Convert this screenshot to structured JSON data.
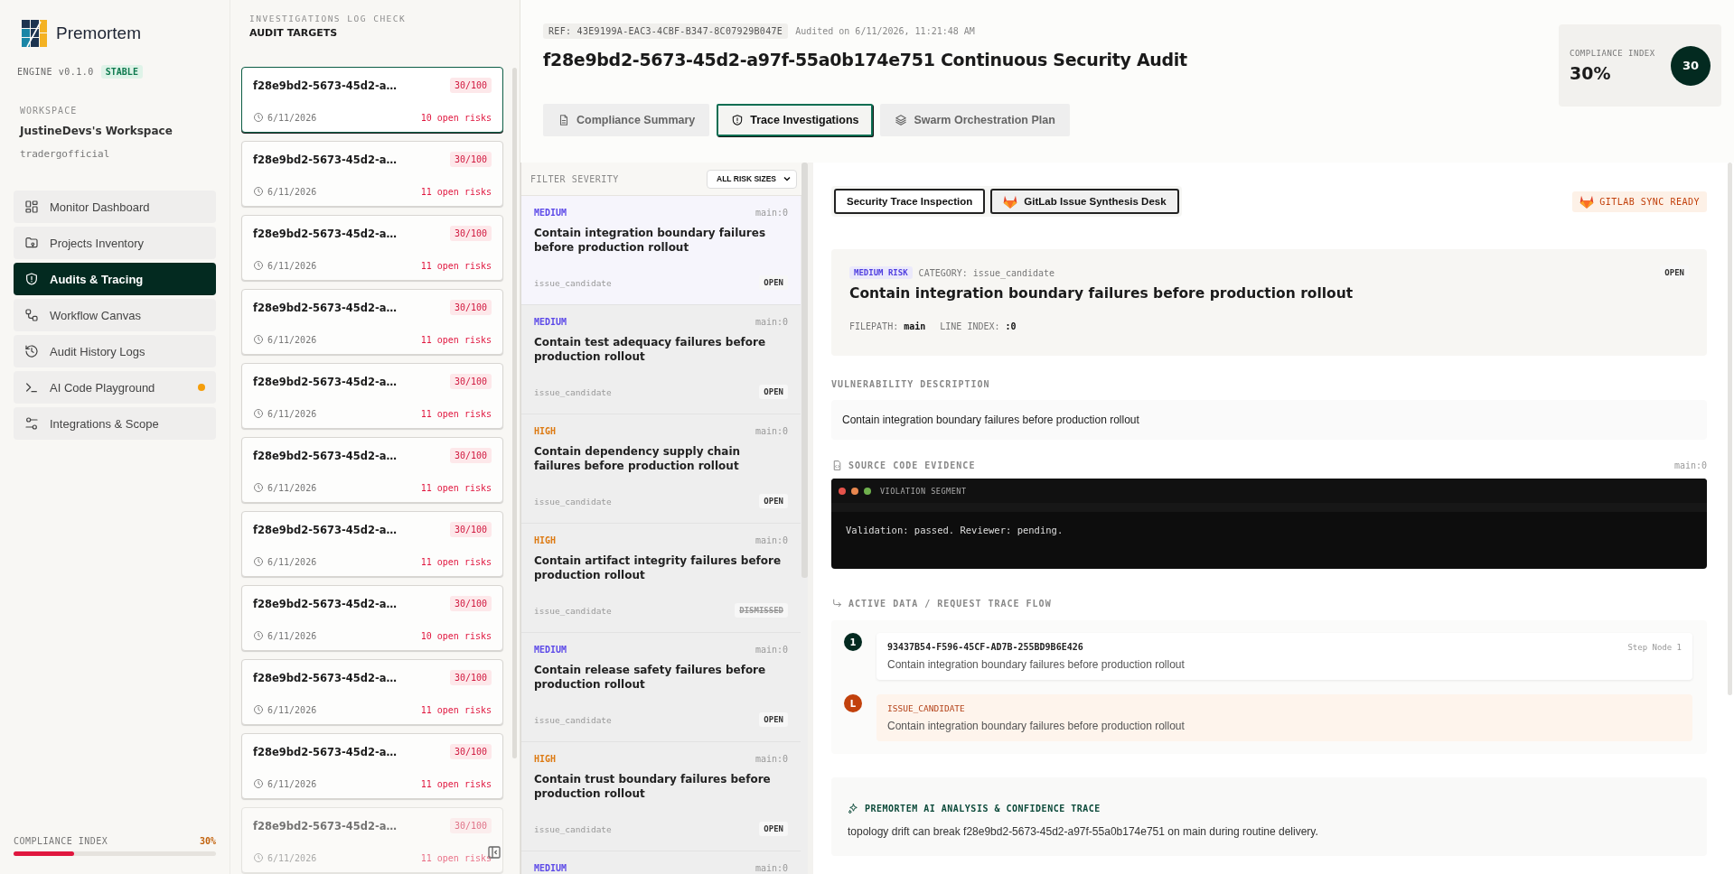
{
  "sidebar": {
    "brand": "Premortem",
    "engine": "ENGINE v0.1.0",
    "engine_badge": "STABLE",
    "workspace_label": "WORKSPACE",
    "workspace_name": "JustineDevs's Workspace",
    "workspace_handle": "tradergofficial",
    "nav": [
      {
        "label": "Monitor Dashboard",
        "selected": false,
        "alert": false
      },
      {
        "label": "Projects Inventory",
        "selected": false,
        "alert": false
      },
      {
        "label": "Audits & Tracing",
        "selected": true,
        "alert": false
      },
      {
        "label": "Workflow Canvas",
        "selected": false,
        "alert": false
      },
      {
        "label": "Audit History Logs",
        "selected": false,
        "alert": false
      },
      {
        "label": "AI Code Playground",
        "selected": false,
        "alert": true
      },
      {
        "label": "Integrations & Scope",
        "selected": false,
        "alert": false
      }
    ],
    "footer": {
      "label": "COMPLIANCE INDEX",
      "value": "30%",
      "level": 0.3
    }
  },
  "audit_list": {
    "eyebrow": "INVESTIGATIONS LOG CHECK",
    "title": "AUDIT TARGETS",
    "items": [
      {
        "name": "f28e9bd2-5673-45d2-a…",
        "score": "30/100",
        "date": "6/11/2026",
        "risks": "10 open risks",
        "selected": true
      },
      {
        "name": "f28e9bd2-5673-45d2-a…",
        "score": "30/100",
        "date": "6/11/2026",
        "risks": "11 open risks",
        "selected": false
      },
      {
        "name": "f28e9bd2-5673-45d2-a…",
        "score": "30/100",
        "date": "6/11/2026",
        "risks": "11 open risks",
        "selected": false
      },
      {
        "name": "f28e9bd2-5673-45d2-a…",
        "score": "30/100",
        "date": "6/11/2026",
        "risks": "11 open risks",
        "selected": false
      },
      {
        "name": "f28e9bd2-5673-45d2-a…",
        "score": "30/100",
        "date": "6/11/2026",
        "risks": "11 open risks",
        "selected": false
      },
      {
        "name": "f28e9bd2-5673-45d2-a…",
        "score": "30/100",
        "date": "6/11/2026",
        "risks": "11 open risks",
        "selected": false
      },
      {
        "name": "f28e9bd2-5673-45d2-a…",
        "score": "30/100",
        "date": "6/11/2026",
        "risks": "11 open risks",
        "selected": false
      },
      {
        "name": "f28e9bd2-5673-45d2-a…",
        "score": "30/100",
        "date": "6/11/2026",
        "risks": "10 open risks",
        "selected": false
      },
      {
        "name": "f28e9bd2-5673-45d2-a…",
        "score": "30/100",
        "date": "6/11/2026",
        "risks": "11 open risks",
        "selected": false
      },
      {
        "name": "f28e9bd2-5673-45d2-a…",
        "score": "30/100",
        "date": "6/11/2026",
        "risks": "11 open risks",
        "selected": false
      },
      {
        "name": "f28e9bd2-5673-45d2-a…",
        "score": "30/100",
        "date": "6/11/2026",
        "risks": "11 open risks",
        "selected": false
      }
    ]
  },
  "header": {
    "ref": "REF: 43E9199A-EAC3-4CBF-B347-8C07929B047E",
    "audited": "Audited on 6/11/2026, 11:21:48 AM",
    "title": "f28e9bd2-5673-45d2-a97f-55a0b174e751 Continuous Security Audit",
    "compliance": {
      "label": "COMPLIANCE INDEX",
      "value": "30%",
      "badge": "30"
    }
  },
  "tabs": [
    {
      "label": "Compliance Summary",
      "selected": false
    },
    {
      "label": "Trace Investigations",
      "selected": true
    },
    {
      "label": "Swarm Orchestration Plan",
      "selected": false
    }
  ],
  "findings": {
    "filter_label": "FILTER SEVERITY",
    "filter_value": "ALL RISK SIZES",
    "items": [
      {
        "severity": "MEDIUM",
        "color": "#5b48e8",
        "location": "main:0",
        "title": "Contain integration boundary failures before production rollout",
        "category": "issue_candidate",
        "status": "OPEN",
        "dismissed": false,
        "selected": true
      },
      {
        "severity": "MEDIUM",
        "color": "#5b48e8",
        "location": "main:0",
        "title": "Contain test adequacy failures before production rollout",
        "category": "issue_candidate",
        "status": "OPEN",
        "dismissed": false,
        "selected": false
      },
      {
        "severity": "HIGH",
        "color": "#dd7a12",
        "location": "main:0",
        "title": "Contain dependency supply chain failures before production rollout",
        "category": "issue_candidate",
        "status": "OPEN",
        "dismissed": false,
        "selected": false
      },
      {
        "severity": "HIGH",
        "color": "#dd7a12",
        "location": "main:0",
        "title": "Contain artifact integrity failures before production rollout",
        "category": "issue_candidate",
        "status": "DISMISSED",
        "dismissed": true,
        "selected": false
      },
      {
        "severity": "MEDIUM",
        "color": "#5b48e8",
        "location": "main:0",
        "title": "Contain release safety failures before production rollout",
        "category": "issue_candidate",
        "status": "OPEN",
        "dismissed": false,
        "selected": false
      },
      {
        "severity": "HIGH",
        "color": "#dd7a12",
        "location": "main:0",
        "title": "Contain trust boundary failures before production rollout",
        "category": "issue_candidate",
        "status": "OPEN",
        "dismissed": false,
        "selected": false
      },
      {
        "severity": "MEDIUM",
        "color": "#5b48e8",
        "location": "main:0",
        "selected": false
      }
    ]
  },
  "detail": {
    "views": [
      {
        "label": "Security Trace Inspection",
        "selected": true
      },
      {
        "label": "GitLab Issue Synthesis Desk",
        "selected": false
      }
    ],
    "sync": "GITLAB SYNC READY",
    "finding": {
      "risk": "MEDIUM RISK",
      "category_label": "CATEGORY:",
      "category": "issue_candidate",
      "status": "OPEN",
      "title": "Contain integration boundary failures before production rollout",
      "filepath_label": "FILEPATH:",
      "filepath": "main",
      "line_label": "LINE INDEX:",
      "line": ":0"
    },
    "description": {
      "heading": "VULNERABILITY DESCRIPTION",
      "text": "Contain integration boundary failures before production rollout"
    },
    "evidence": {
      "heading": "SOURCE CODE EVIDENCE",
      "location": "main:0",
      "segment": "VIOLATION SEGMENT",
      "code": "Validation: passed. Reviewer: pending."
    },
    "trace": {
      "heading": "ACTIVE DATA / REQUEST TRACE FLOW",
      "steps": [
        {
          "kind": "node",
          "marker": "1",
          "id": "93437B54-F596-45CF-AD7B-255BD9B6E426",
          "step": "Step Node 1",
          "text": "Contain integration boundary failures before production rollout"
        },
        {
          "kind": "leaf",
          "marker": "L",
          "id": "ISSUE_CANDIDATE",
          "text": "Contain integration boundary failures before production rollout"
        }
      ]
    },
    "analysis": {
      "heading": "PREMORTEM AI ANALYSIS & CONFIDENCE TRACE",
      "text": "topology drift can break f28e9bd2-5673-45d2-a97f-55a0b174e751 on main during routine delivery."
    }
  }
}
